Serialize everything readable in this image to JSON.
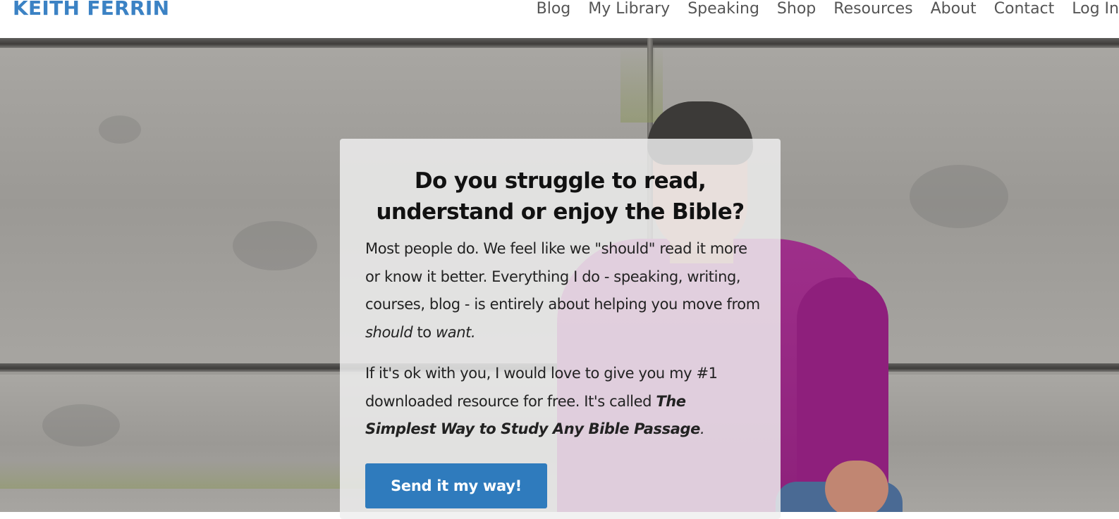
{
  "header": {
    "brand": "KEITH FERRIN",
    "nav": [
      "Blog",
      "My Library",
      "Speaking",
      "Shop",
      "Resources",
      "About",
      "Contact",
      "Log In"
    ]
  },
  "hero": {
    "headline_line1": "Do you struggle to read,",
    "headline_line2": "understand or enjoy the Bible?",
    "p1_text": "Most people do. We feel like we \"should\" read it more or know it better. Everything I do - speaking, writing, courses, blog - is entirely about helping you move from ",
    "p1_should": "should",
    "p1_to": " to ",
    "p1_want": "want.",
    "p2_text": "If it's ok with you, I would love to give you my #1 downloaded resource for free. It's called ",
    "p2_title": "The Simplest Way to Study Any Bible Passage",
    "p2_end": ".",
    "cta_label": "Send it my way!"
  },
  "colors": {
    "brand": "#3b82c4",
    "nav_text": "#555555",
    "cta_bg": "#2f7bbd",
    "shirt": "#9e2f8a"
  }
}
